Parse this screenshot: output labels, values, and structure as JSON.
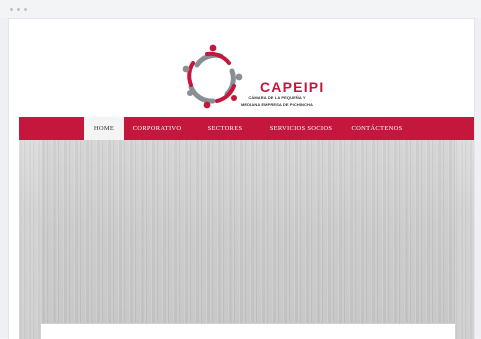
{
  "brand": {
    "name": "CAPEIPI",
    "subtitle_line1": "CÁMARA DE LA PEQUEÑA Y",
    "subtitle_line2": "MEDIANA EMPRESA DE PICHINCHA",
    "colors": {
      "primary": "#c4173d",
      "grey": "#8a8f96"
    }
  },
  "nav": {
    "items": [
      {
        "label": "HOME",
        "active": true
      },
      {
        "label": "CORPORATIVO",
        "active": false
      },
      {
        "label": "SECTORES",
        "active": false
      },
      {
        "label": "SERVICIOS SOCIOS",
        "active": false
      },
      {
        "label": "CONTÁCTENOS",
        "active": false
      }
    ]
  }
}
